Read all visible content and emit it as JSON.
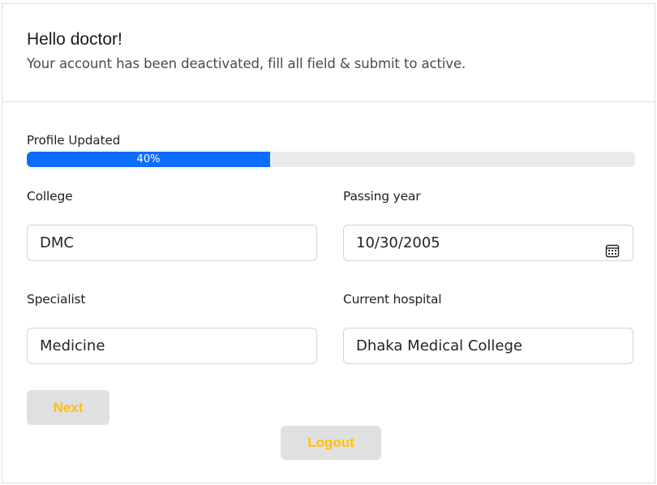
{
  "header": {
    "greeting": "Hello doctor!",
    "notice": "Your account has been deactivated, fill all field & submit to active."
  },
  "progress": {
    "label": "Profile Updated",
    "value_percent": 40,
    "text": "40%",
    "fill_color": "#0d6efd"
  },
  "form": {
    "college": {
      "label": "College",
      "value": "DMC"
    },
    "passing_year": {
      "label": "Passing year",
      "value": "10/30/2005",
      "icon": "calendar-icon"
    },
    "specialist": {
      "label": "Specialist",
      "value": "Medicine"
    },
    "current_hospital": {
      "label": "Current hospital",
      "value": "Dhaka Medical College"
    }
  },
  "buttons": {
    "next_label": "Next",
    "logout_label": "Logout",
    "text_color": "#ffc107",
    "background": "#e0e0e0"
  }
}
